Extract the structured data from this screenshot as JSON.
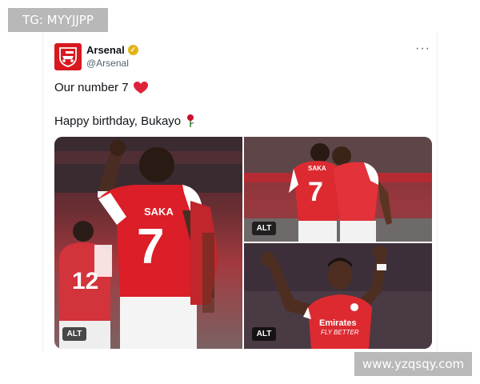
{
  "watermarks": {
    "top": "TG: MYYJJPP",
    "bottom": "www.yzqsqy.com"
  },
  "tweet": {
    "account_name": "Arsenal",
    "handle": "@Arsenal",
    "more_label": "···",
    "text_line1": "Our number 7",
    "text_line2": "Happy birthday, Bukayo",
    "icons": [
      "arsenal-crest-icon",
      "verified-badge-icon",
      "more-options-icon",
      "red-heart-icon",
      "rose-icon"
    ]
  },
  "media": {
    "images": [
      {
        "alt_label": "ALT",
        "shirt_name": "SAKA",
        "shirt_number": "7",
        "second_number": "12"
      },
      {
        "alt_label": "ALT",
        "shirt_name": "SAKA",
        "shirt_number": "7"
      },
      {
        "alt_label": "ALT",
        "sponsor_line1": "Emirates",
        "sponsor_line2": "FLY BETTER"
      }
    ]
  },
  "colors": {
    "brand_red": "#db0007",
    "verified_gold": "#e2b419",
    "text": "#0f1419",
    "handle_gray": "#536471"
  }
}
